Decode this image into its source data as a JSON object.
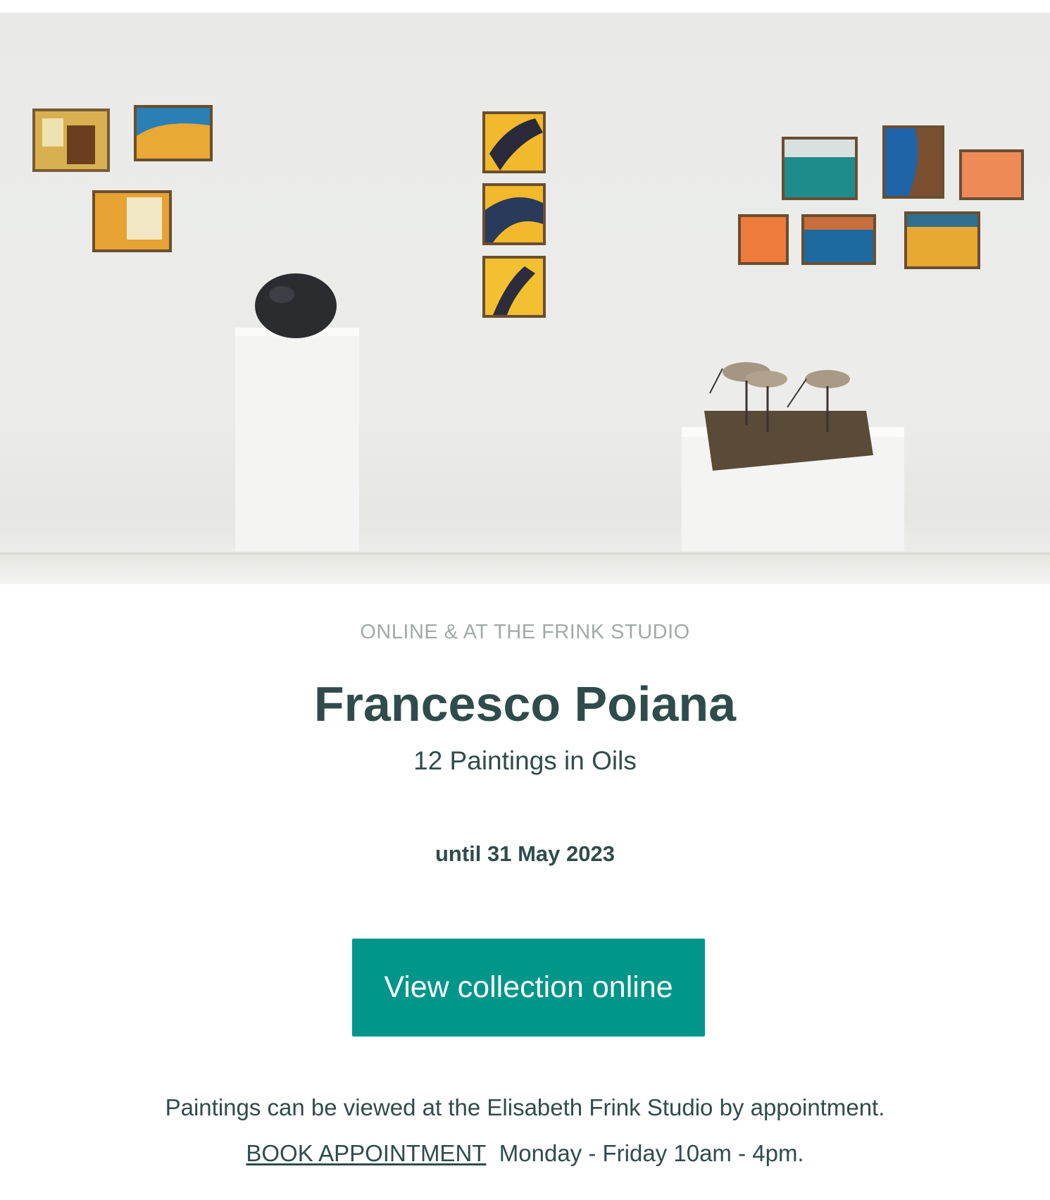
{
  "hero": {
    "image_label": "Gallery installation view with paintings, a stone sculpture and bird sculptures on plinths"
  },
  "header": {
    "kicker": "ONLINE & AT THE FRINK STUDIO",
    "title": "Francesco Poiana",
    "subtitle": "12 Paintings in Oils"
  },
  "exhibition": {
    "date": "until 31 May 2023"
  },
  "cta": {
    "label": "View collection online"
  },
  "info": {
    "line1": "Paintings can be viewed at the Elisabeth Frink Studio by appointment.",
    "book_link": "BOOK APPOINTMENT",
    "hours": "Monday - Friday 10am - 4pm."
  },
  "colors": {
    "accent": "#00968a",
    "text": "#2f4c4b",
    "muted": "#a2a9a8"
  }
}
